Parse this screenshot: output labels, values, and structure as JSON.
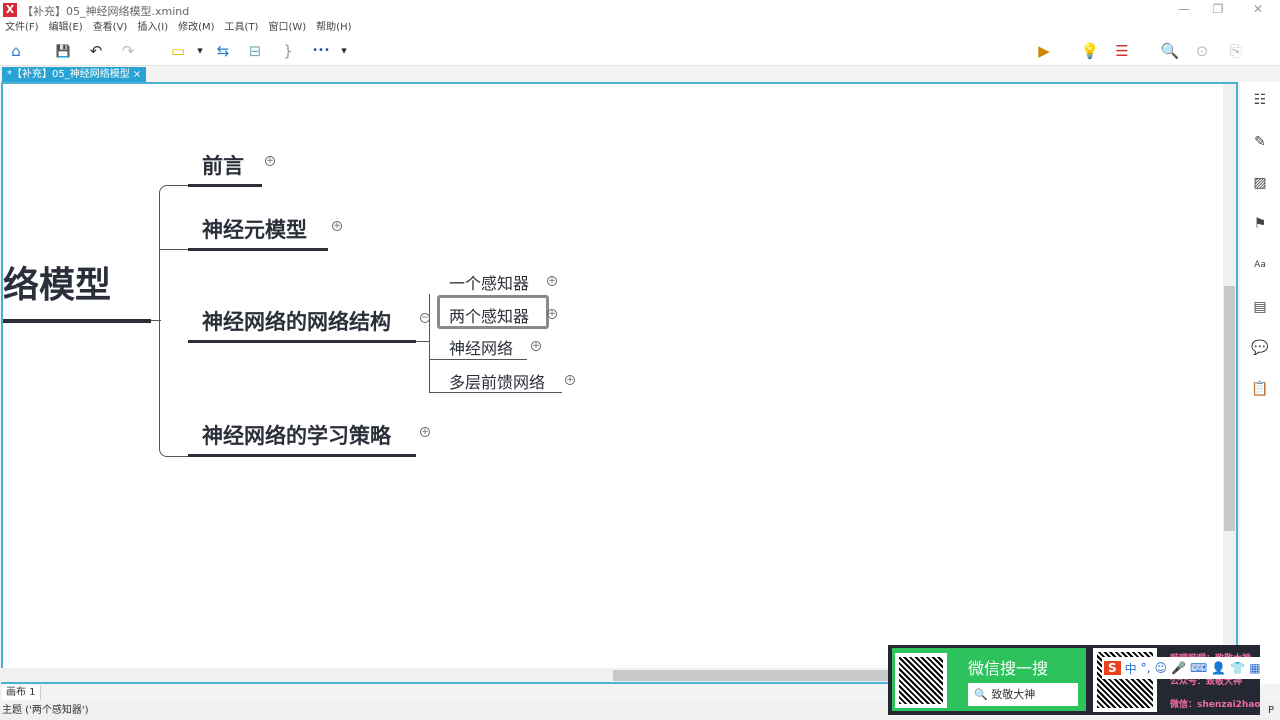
{
  "window": {
    "title": "【补充】05_神经网络模型.xmind",
    "logo": "X",
    "minimize": "—",
    "restore": "❐",
    "close": "✕"
  },
  "menu": [
    "文件(F)",
    "编辑(E)",
    "查看(V)",
    "插入(I)",
    "修改(M)",
    "工具(T)",
    "窗口(W)",
    "帮助(H)"
  ],
  "toolbar": {
    "home": "⌂",
    "save": "💾",
    "undo": "↶",
    "redo": "↷",
    "topic": "▭",
    "dropdown": "▾",
    "relationship": "⇆",
    "boundary": "⊟",
    "summary": "}",
    "more": "•••",
    "present": "▶",
    "idea": "💡",
    "gantt": "☰",
    "search": "🔍",
    "share": "⊙",
    "export": "⎘"
  },
  "tab": {
    "label": "*【补充】05_神经网络模型",
    "close": "×"
  },
  "mindmap": {
    "central": "络模型",
    "topics": [
      {
        "label": "前言"
      },
      {
        "label": "神经元模型"
      },
      {
        "label": "神经网络的网络结构",
        "subtopics": [
          "一个感知器",
          "两个感知器",
          "神经网络",
          "多层前馈网络"
        ]
      },
      {
        "label": "神经网络的学习策略"
      }
    ],
    "expand": "+",
    "collapse": "−",
    "selected": "两个感知器"
  },
  "sidebar": [
    "☷",
    "✎",
    "▨",
    "⚑",
    "Aa",
    "▤",
    "💬",
    "📋"
  ],
  "sheet": "画布 1",
  "status": "主题 ('两个感知器')",
  "status_right": "P",
  "promo": {
    "wechat_search": "微信搜一搜",
    "search_text": "致敬大神",
    "bilibili": "哔哩哔哩：致敬大神",
    "gongzhonghao": "公众号：致敬大神",
    "weixin": "微信：shenzai2hao"
  },
  "ime": {
    "logo": "S",
    "lang": "中",
    "punct": "°,",
    "emoji": "☺",
    "mic": "🎤",
    "keyboard": "⌨",
    "user": "👤",
    "skin": "👕",
    "apps": "▦"
  }
}
